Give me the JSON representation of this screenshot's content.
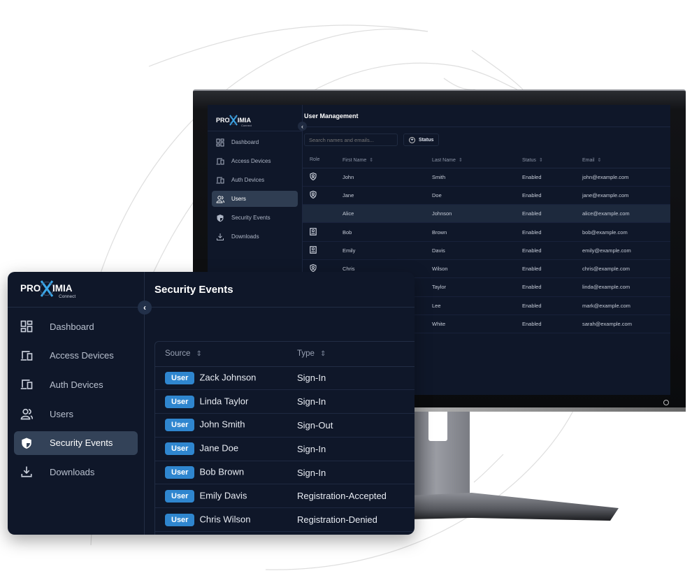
{
  "brand": {
    "logo_text_left": "PRO",
    "logo_text_right": "IMIA",
    "logo_sub": "Connect",
    "accent_color": "#2f86cf"
  },
  "nav_items": [
    {
      "label": "Dashboard",
      "icon": "dashboard-icon"
    },
    {
      "label": "Access Devices",
      "icon": "devices-icon"
    },
    {
      "label": "Auth Devices",
      "icon": "devices-icon"
    },
    {
      "label": "Users",
      "icon": "users-icon"
    },
    {
      "label": "Security Events",
      "icon": "shield-icon"
    },
    {
      "label": "Downloads",
      "icon": "download-icon"
    }
  ],
  "monitor_app": {
    "active_nav": "Users",
    "title": "User Management",
    "search_placeholder": "Search names and emails...",
    "status_filter_label": "Status",
    "columns": [
      "Role",
      "First Name",
      "Last Name",
      "Status",
      "Email"
    ],
    "rows": [
      {
        "role_icon": "shield-user-icon",
        "first": "John",
        "last": "Smith",
        "status": "Enabled",
        "email": "john@example.com"
      },
      {
        "role_icon": "shield-user-icon",
        "first": "Jane",
        "last": "Doe",
        "status": "Enabled",
        "email": "jane@example.com"
      },
      {
        "role_icon": "",
        "first": "Alice",
        "last": "Johnson",
        "status": "Enabled",
        "email": "alice@example.com",
        "highlighted": true
      },
      {
        "role_icon": "id-badge-icon",
        "first": "Bob",
        "last": "Brown",
        "status": "Enabled",
        "email": "bob@example.com"
      },
      {
        "role_icon": "id-badge-icon",
        "first": "Emily",
        "last": "Davis",
        "status": "Enabled",
        "email": "emily@example.com"
      },
      {
        "role_icon": "shield-user-icon",
        "first": "Chris",
        "last": "Wilson",
        "status": "Enabled",
        "email": "chris@example.com"
      },
      {
        "role_icon": "",
        "first": "",
        "last": "Taylor",
        "status": "Enabled",
        "email": "linda@example.com"
      },
      {
        "role_icon": "",
        "first": "",
        "last": "Lee",
        "status": "Enabled",
        "email": "mark@example.com"
      },
      {
        "role_icon": "",
        "first": "",
        "last": "White",
        "status": "Enabled",
        "email": "sarah@example.com"
      }
    ]
  },
  "panel_app": {
    "active_nav": "Security Events",
    "title": "Security Events",
    "columns": [
      "Source",
      "Type"
    ],
    "rows": [
      {
        "badge": "User",
        "source": "Zack Johnson",
        "type": "Sign-In"
      },
      {
        "badge": "User",
        "source": "Linda Taylor",
        "type": "Sign-In"
      },
      {
        "badge": "User",
        "source": "John Smith",
        "type": "Sign-Out"
      },
      {
        "badge": "User",
        "source": "Jane Doe",
        "type": "Sign-In"
      },
      {
        "badge": "User",
        "source": "Bob Brown",
        "type": "Sign-In"
      },
      {
        "badge": "User",
        "source": "Emily Davis",
        "type": "Registration-Accepted"
      },
      {
        "badge": "User",
        "source": "Chris Wilson",
        "type": "Registration-Denied"
      }
    ]
  }
}
